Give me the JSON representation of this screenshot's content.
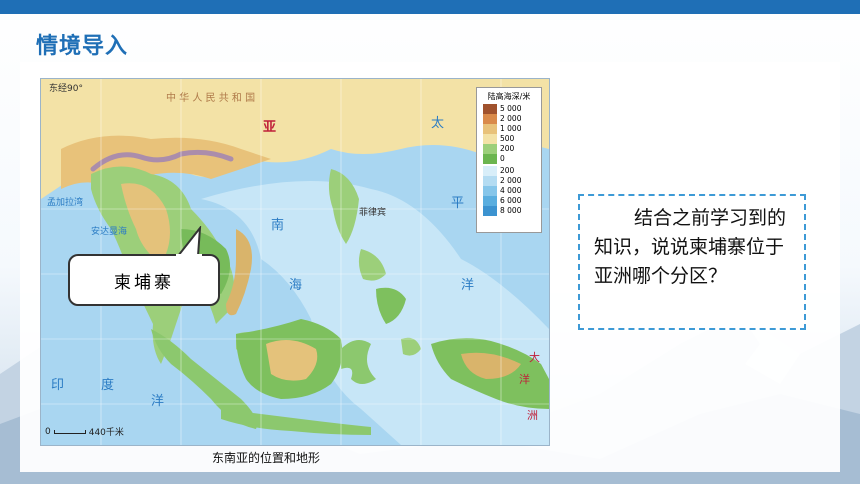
{
  "header": {
    "title": "情境导入"
  },
  "map": {
    "caption": "东南亚的位置和地形",
    "legend_title": "陆高海深/米",
    "legend_land": [
      "5 000",
      "2 000",
      "1 000",
      "500",
      "200",
      "0"
    ],
    "legend_sea": [
      "200",
      "2 000",
      "4 000",
      "6 000",
      "8 000"
    ],
    "scale_label": "440千米",
    "scale_zero": "0",
    "longitude_label": "东经90°",
    "labels": {
      "asia": "亚",
      "china": "中 华 人 民 共 和 国",
      "ocean_tai": "太",
      "ocean_ping": "平",
      "ocean_yang": "洋",
      "sea_nan": "南",
      "sea_hai": "海",
      "bengal": "孟加拉湾",
      "andaman": "安达曼海",
      "indian_yin": "印",
      "indian_du": "度",
      "indian_yang": "洋",
      "philippines": "菲律宾",
      "oceania_da": "大",
      "oceania_yang": "洋",
      "oceania_zhou": "洲"
    }
  },
  "callout": {
    "text": "柬埔寨"
  },
  "question": {
    "text": "结合之前学习到的知识，说说柬埔寨位于亚洲哪个分区？"
  }
}
